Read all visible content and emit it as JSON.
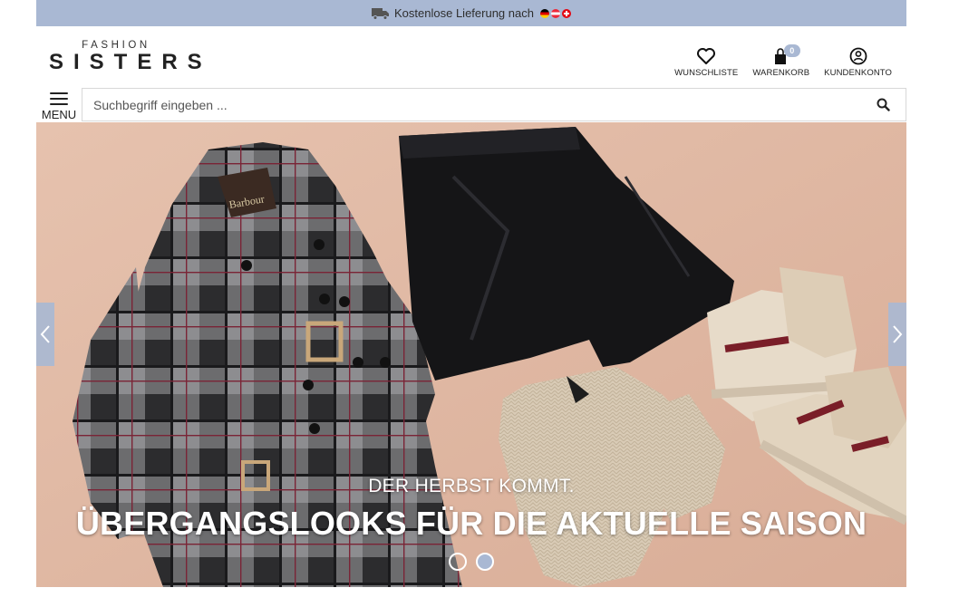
{
  "topbar": {
    "text": "Kostenlose Lieferung nach",
    "flags": [
      "de-flag-icon",
      "at-flag-icon",
      "ch-flag-icon"
    ]
  },
  "logo": {
    "top": "FASHION",
    "main": "SISTERS"
  },
  "header": {
    "wishlist_label": "WUNSCHLISTE",
    "cart_label": "WARENKORB",
    "cart_count": "0",
    "account_label": "KUNDENKONTO"
  },
  "menu": {
    "label": "MENU"
  },
  "search": {
    "placeholder": "Suchbegriff eingeben ...",
    "value": ""
  },
  "hero": {
    "subtitle": "DER HERBST KOMMT.",
    "title": "ÜBERGANGSLOOKS FÜR DIE AKTUELLE SAISON",
    "slide_count": 2,
    "active_slide": 2
  },
  "colors": {
    "accent": "#a9b8d3",
    "hero_background": "#e2b9a4"
  }
}
